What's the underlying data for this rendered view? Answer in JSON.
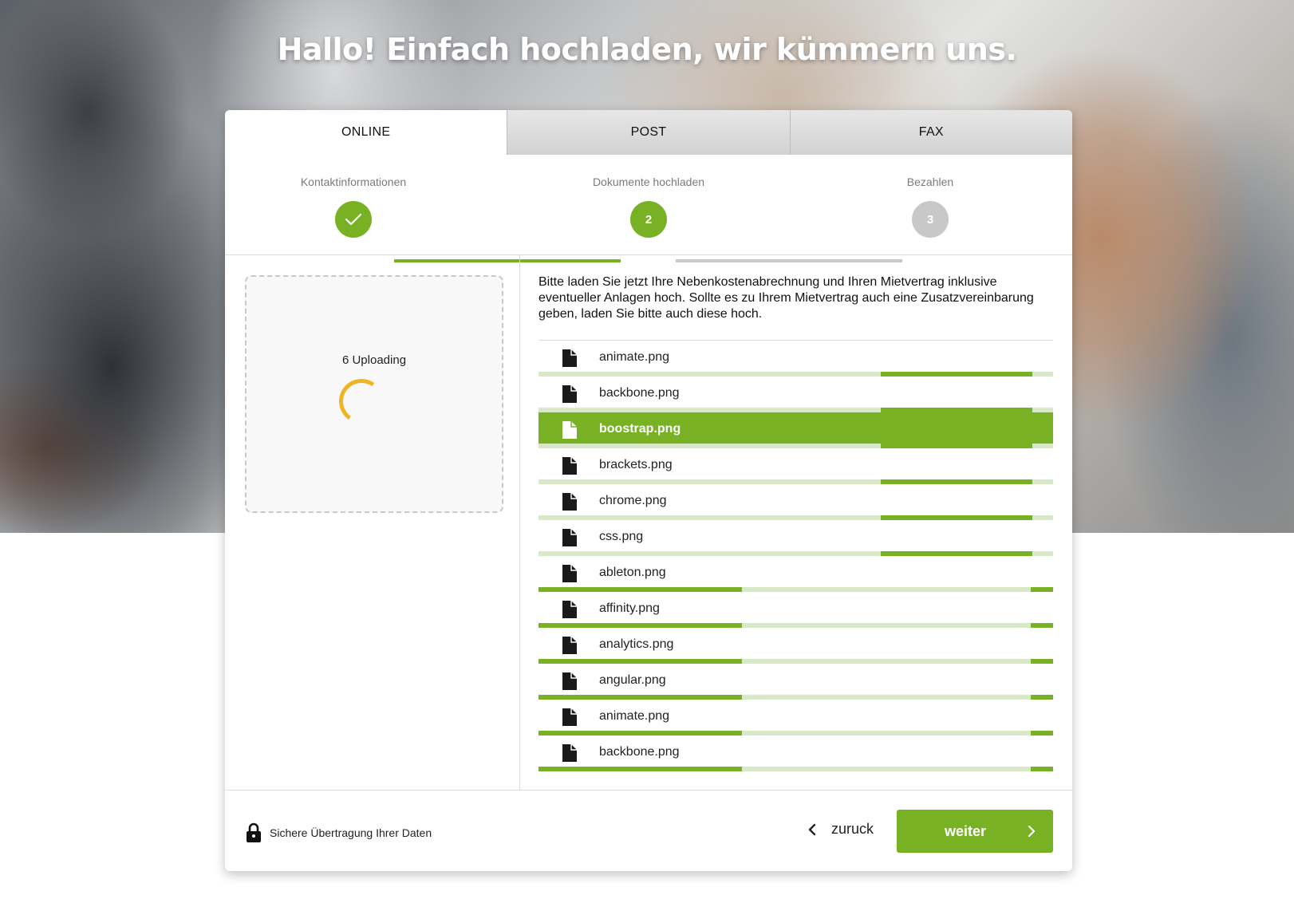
{
  "hero": {
    "title": "Hallo! Einfach hochladen, wir kümmern uns."
  },
  "tabs": [
    {
      "label": "ONLINE",
      "active": true
    },
    {
      "label": "POST",
      "active": false
    },
    {
      "label": "FAX",
      "active": false
    }
  ],
  "stepper": {
    "steps": [
      {
        "label": "Kontaktinformationen",
        "state": "done",
        "marker": ""
      },
      {
        "label": "Dokumente hochladen",
        "state": "current",
        "marker": "2"
      },
      {
        "label": "Bezahlen",
        "state": "todo",
        "marker": "3"
      }
    ]
  },
  "dropzone": {
    "status": "6 Uploading"
  },
  "instructions": "Bitte laden Sie jetzt Ihre Nebenkostenabrechnung und Ihren Mietvertrag inklusive eventueller Anlagen hoch. Sollte es zu Ihrem Mietvertrag auch eine Zusatzvereinbarung geben, laden Sie bitte auch diese hoch.",
  "files": [
    {
      "name": "animate.png",
      "selected": false,
      "progress_segments": [
        [
          0.665,
          0.96
        ]
      ]
    },
    {
      "name": "backbone.png",
      "selected": false,
      "progress_segments": [
        [
          0.665,
          0.96
        ]
      ]
    },
    {
      "name": "boostrap.png",
      "selected": true,
      "progress_segments": [
        [
          0.665,
          0.96
        ]
      ]
    },
    {
      "name": "brackets.png",
      "selected": false,
      "progress_segments": [
        [
          0.665,
          0.96
        ]
      ]
    },
    {
      "name": "chrome.png",
      "selected": false,
      "progress_segments": [
        [
          0.665,
          0.96
        ]
      ]
    },
    {
      "name": "css.png",
      "selected": false,
      "progress_segments": [
        [
          0.665,
          0.96
        ]
      ]
    },
    {
      "name": "ableton.png",
      "selected": false,
      "progress_segments": [
        [
          0,
          0.395
        ],
        [
          0.956,
          1
        ]
      ]
    },
    {
      "name": "affinity.png",
      "selected": false,
      "progress_segments": [
        [
          0,
          0.395
        ],
        [
          0.956,
          1
        ]
      ]
    },
    {
      "name": "analytics.png",
      "selected": false,
      "progress_segments": [
        [
          0,
          0.395
        ],
        [
          0.956,
          1
        ]
      ]
    },
    {
      "name": "angular.png",
      "selected": false,
      "progress_segments": [
        [
          0,
          0.395
        ],
        [
          0.956,
          1
        ]
      ]
    },
    {
      "name": "animate.png",
      "selected": false,
      "progress_segments": [
        [
          0,
          0.395
        ],
        [
          0.956,
          1
        ]
      ]
    },
    {
      "name": "backbone.png",
      "selected": false,
      "progress_segments": [
        [
          0,
          0.395
        ],
        [
          0.956,
          1
        ]
      ]
    }
  ],
  "footer": {
    "secure_text": "Sichere Übertragung Ihrer Daten",
    "back_label": "zuruck",
    "next_label": "weiter"
  },
  "colors": {
    "accent": "#78b224",
    "track": "#d9e8c6",
    "pending": "#c8c8c8",
    "spinner": "#f0b323"
  },
  "icons": {
    "step_done": "check-icon",
    "file": "file-icon",
    "secure": "lock-icon",
    "back": "chevron-left-icon",
    "next": "chevron-right-icon"
  }
}
